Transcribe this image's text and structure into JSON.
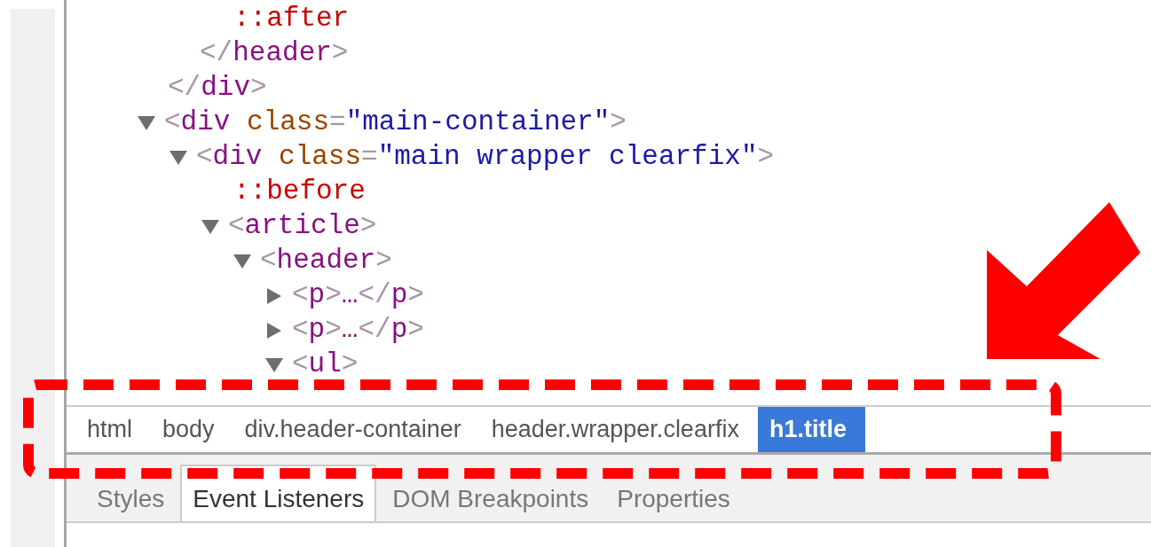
{
  "dom_tree": [
    {
      "kind": "partial",
      "closing": "</div>",
      "children": [
        {
          "kind": "partial",
          "closing": "</header>",
          "children": [
            {
              "kind": "pseudo",
              "text": "::after"
            }
          ]
        }
      ]
    },
    {
      "kind": "element",
      "text": "<div class=\"main-container\">",
      "expanded": true,
      "children": [
        {
          "kind": "element",
          "text": "<div class=\"main wrapper clearfix\">",
          "expanded": true,
          "children": [
            {
              "kind": "pseudo",
              "text": "::before"
            },
            {
              "kind": "element",
              "text": "<article>",
              "expanded": true,
              "children": [
                {
                  "kind": "element",
                  "text": "<header>",
                  "expanded": true,
                  "children": [
                    {
                      "kind": "element",
                      "text": "<p>…</p>",
                      "expanded": false
                    },
                    {
                      "kind": "element",
                      "text": "<p>…</p>",
                      "expanded": false
                    },
                    {
                      "kind": "element",
                      "text": "<ul>",
                      "expanded": true
                    }
                  ]
                }
              ]
            }
          ]
        }
      ]
    }
  ],
  "breadcrumbs": [
    {
      "label": "html",
      "selected": false
    },
    {
      "label": "body",
      "selected": false
    },
    {
      "label": "div.header-container",
      "selected": false
    },
    {
      "label": "header.wrapper.clearfix",
      "selected": false
    },
    {
      "label": "h1.title",
      "selected": true
    }
  ],
  "tabs": [
    {
      "label": "Styles",
      "selected": false
    },
    {
      "label": "Event Listeners",
      "selected": true
    },
    {
      "label": "DOM Breakpoints",
      "selected": false
    },
    {
      "label": "Properties",
      "selected": false
    }
  ]
}
